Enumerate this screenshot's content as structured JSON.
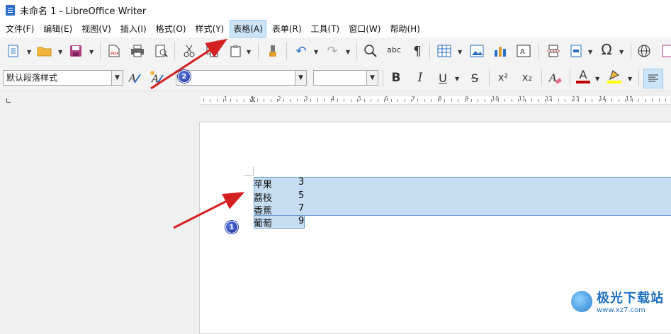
{
  "window": {
    "title": "未命名 1 - LibreOffice Writer"
  },
  "menubar": {
    "items": [
      "文件(F)",
      "编辑(E)",
      "视图(V)",
      "插入(I)",
      "格式(O)",
      "样式(Y)",
      "表格(A)",
      "表单(R)",
      "工具(T)",
      "窗口(W)",
      "帮助(H)"
    ],
    "active_index": 6
  },
  "formatting": {
    "paragraph_style": "默认段落样式",
    "font_name": "",
    "font_size": "",
    "bold_label": "B",
    "italic_label": "I",
    "underline_label": "U",
    "strike_label": "S",
    "superscript_label": "x²",
    "subscript_label": "x₂",
    "font_color_label": "A",
    "font_color": "#c00000",
    "highlight_color": "#ffff00"
  },
  "ruler": {
    "numbers": [
      "1",
      "1",
      "2",
      "3",
      "4",
      "5",
      "6",
      "7",
      "8",
      "9",
      "10",
      "11",
      "12",
      "13",
      "14",
      "15"
    ]
  },
  "document": {
    "rows": [
      {
        "name": "苹果",
        "value": "3"
      },
      {
        "name": "荔枝",
        "value": "5"
      },
      {
        "name": "香蕉",
        "value": "7"
      },
      {
        "name": "葡萄",
        "value": "9"
      }
    ]
  },
  "annotations": {
    "badge1": "1",
    "badge2": "2",
    "arrow_color": "#d42020"
  },
  "watermark": {
    "title": "极光下载站",
    "url": "www.xz7.com"
  }
}
